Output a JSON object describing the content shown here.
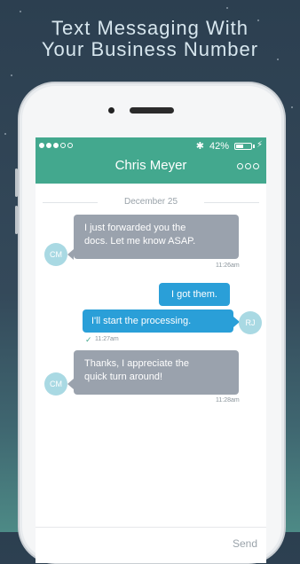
{
  "headline": {
    "line1": "Text Messaging With",
    "line2": "Your Business Number"
  },
  "status_bar": {
    "bluetooth": "✱",
    "battery": "42%",
    "charging": "⚡"
  },
  "header": {
    "title": "Chris Meyer"
  },
  "conversation": {
    "date": "December 25",
    "messages": [
      {
        "avatar": "CM",
        "text_line1": "I just forwarded you the",
        "text_line2": "docs. Let me know ASAP.",
        "time": "11:26am"
      },
      {
        "text": "I got them."
      },
      {
        "avatar": "RJ",
        "text": "I'll start the processing.",
        "time": "11:27am",
        "delivered": "✓"
      },
      {
        "avatar": "CM",
        "text_line1": "Thanks, I appreciate the",
        "text_line2": "quick turn around!",
        "time": "11:28am"
      }
    ]
  },
  "compose": {
    "send_label": "Send"
  },
  "colors": {
    "accent": "#43a88e",
    "outgoing": "#2a9fd8",
    "incoming": "#9aa2ad"
  }
}
